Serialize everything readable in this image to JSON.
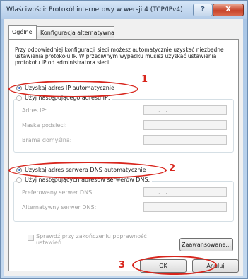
{
  "window": {
    "title": "Właściwości: Protokół internetowy w wersji 4 (TCP/IPv4)",
    "help_label": "?",
    "close_label": "X"
  },
  "tabs": [
    {
      "label": "Ogólne"
    },
    {
      "label": "Konfiguracja alternatywna"
    }
  ],
  "intro": "Przy odpowiedniej konfiguracji sieci możesz automatycznie uzyskać niezbędne ustawienia protokołu IP. W przeciwnym wypadku musisz uzyskać ustawienia protokołu IP od administratora sieci.",
  "ip": {
    "auto_label": "Uzyskaj adres IP automatycznie",
    "auto_selected": true,
    "manual_label": "Użyj następującego adresu IP:",
    "fields": [
      {
        "label": "Adres IP:",
        "value": ". . ."
      },
      {
        "label": "Maska podsieci:",
        "value": ". . ."
      },
      {
        "label": "Brama domyślna:",
        "value": ". . ."
      }
    ]
  },
  "dns": {
    "auto_label": "Uzyskaj adres serwera DNS automatycznie",
    "auto_selected": true,
    "manual_label": "Użyj następujących adresów serwerów DNS:",
    "fields": [
      {
        "label": "Preferowany serwer DNS:",
        "value": ". . ."
      },
      {
        "label": "Alternatywny serwer DNS:",
        "value": ". . ."
      }
    ]
  },
  "validate": {
    "label_line1": "Sprawdź przy zakończeniu poprawność",
    "label_line2": "ustawień",
    "checked": false
  },
  "advanced_button": "Zaawansowane...",
  "ok_button": "OK",
  "cancel_button": "Anuluj",
  "annotations": {
    "n1": "1",
    "n2": "2",
    "n3": "3",
    "color": "#d8251c"
  }
}
